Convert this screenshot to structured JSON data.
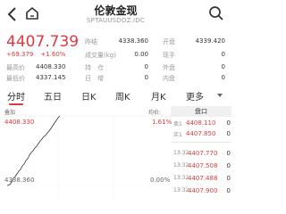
{
  "header": {
    "title": "伦敦金现",
    "subtitle": "SPTAUUSDOZ.IDC"
  },
  "quote": {
    "price": "4407.739",
    "change": "+69.379",
    "change_pct": "+1.60%",
    "high_label": "最高价",
    "high": "4408.330",
    "low_label": "最低价",
    "low": "4337.145",
    "stats": [
      {
        "label": "昨结",
        "value": "4338.360"
      },
      {
        "label": "成交量(kg)",
        "value": "0.00"
      },
      {
        "label": "持　仓",
        "value": "0"
      },
      {
        "label": "日　增",
        "value": "0"
      },
      {
        "label": "开盘",
        "value": "4339.420"
      },
      {
        "label": "现手",
        "value": "0"
      },
      {
        "label": "外盘",
        "value": "0"
      },
      {
        "label": "内盘",
        "value": "0"
      }
    ]
  },
  "tabs": [
    "分时",
    "五日",
    "日K",
    "周K",
    "月K",
    "更多"
  ],
  "chart": {
    "left_head": "叠加",
    "right_head": "均价:",
    "high": "4408.330",
    "high_pct": "1.61%",
    "low": "4338.360",
    "low_pct": "0.00%"
  },
  "book": {
    "title": "盘口",
    "top_rows": [
      {
        "label": "卖1",
        "price": "4408.110",
        "volume": "0"
      },
      {
        "label": "买1",
        "price": "4407.850",
        "volume": "0"
      }
    ],
    "ticks": [
      {
        "label": "13:32",
        "price": "4407.770",
        "volume": "0"
      },
      {
        "label": "13:32",
        "price": "4407.508",
        "volume": "0"
      },
      {
        "label": "13:32",
        "price": "4407.488",
        "volume": "0"
      },
      {
        "label": "13:32",
        "price": "4407.900",
        "volume": "0"
      }
    ]
  },
  "colors": {
    "up": "#e0383e",
    "muted": "#999999",
    "text": "#222222"
  }
}
